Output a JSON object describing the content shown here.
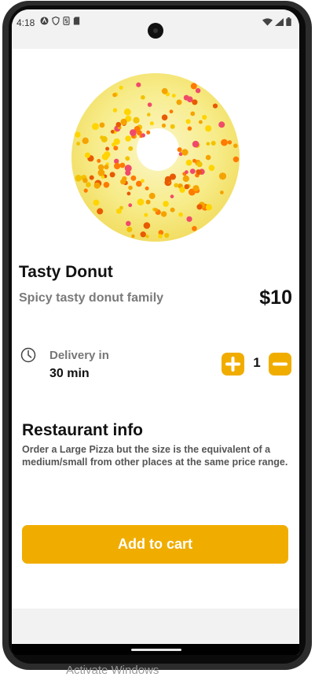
{
  "status_bar": {
    "time": "4:18",
    "left_icons": [
      "a-circle-icon",
      "shield-icon",
      "s-icon",
      "sd-card-icon"
    ],
    "right_icons": [
      "wifi-icon",
      "signal-icon",
      "battery-icon"
    ]
  },
  "product": {
    "image": "donut-image",
    "title": "Tasty Donut",
    "subtitle": "Spicy tasty donut family",
    "price": "$10"
  },
  "delivery": {
    "label": "Delivery in",
    "time": "30 min"
  },
  "quantity": {
    "value": "1"
  },
  "restaurant": {
    "heading": "Restaurant info",
    "body": "Order a Large Pizza but the size is the equivalent of a medium/small from other places at the same price range."
  },
  "cta": {
    "label": "Add to cart"
  },
  "watermark": "Activate Windows",
  "colors": {
    "accent": "#f0ad00",
    "icing": "#f7ec8a",
    "text_dark": "#111111",
    "text_muted": "#7a7a7a"
  }
}
